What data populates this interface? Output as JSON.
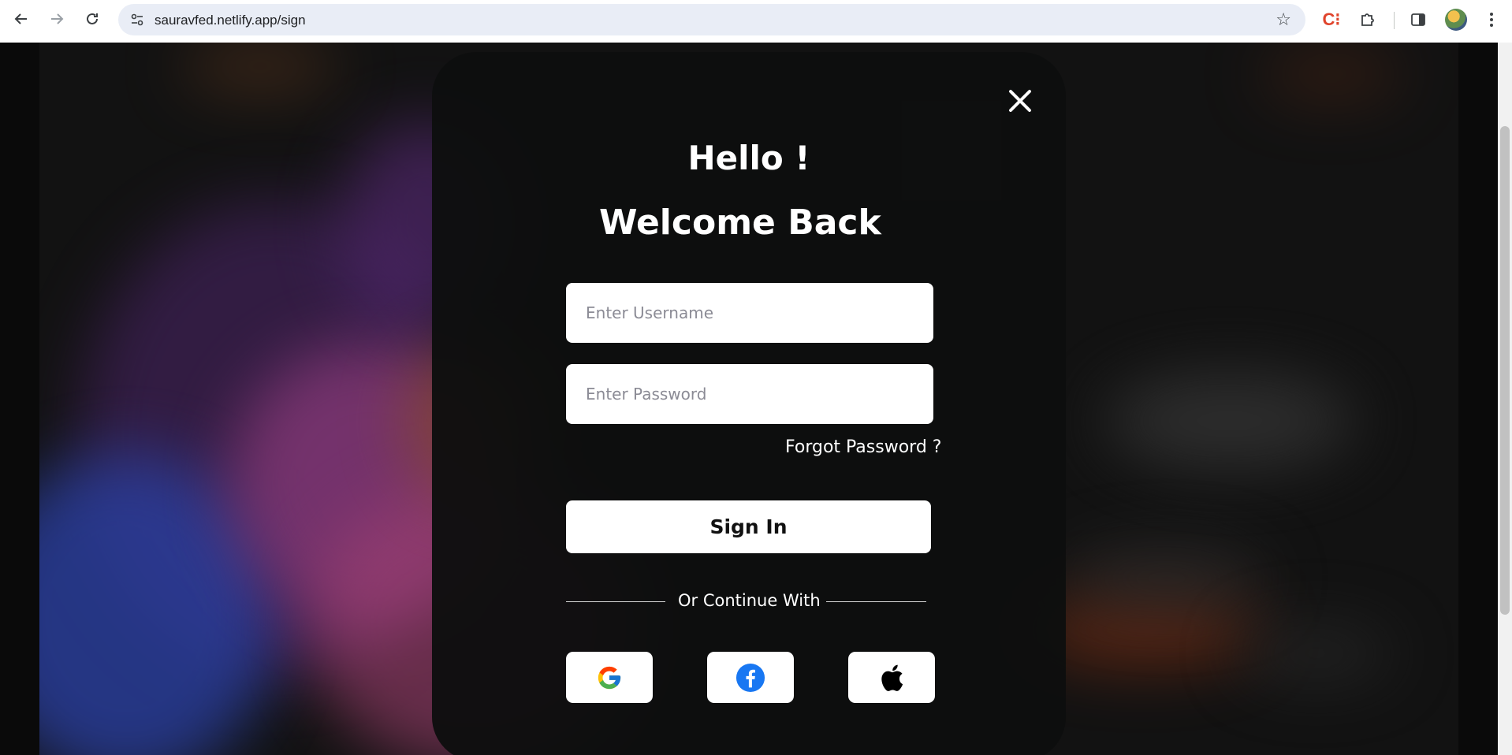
{
  "browser": {
    "url": "sauravfed.netlify.app/sign"
  },
  "modal": {
    "greeting": "Hello !",
    "subtitle": "Welcome Back",
    "username_placeholder": "Enter Username",
    "password_placeholder": "Enter Password",
    "forgot_label": "Forgot Password ?",
    "signin_label": "Sign In",
    "separator_label": "Or Continue With",
    "social": [
      {
        "name": "google-icon"
      },
      {
        "name": "facebook-icon"
      },
      {
        "name": "apple-icon"
      }
    ]
  },
  "colors": {
    "modal_bg": "#0e0f0f",
    "text": "#ffffff",
    "google_blue": "#4285F4",
    "google_red": "#EA4335",
    "google_yellow": "#FBBC05",
    "google_green": "#34A853",
    "facebook_blue": "#1877F2"
  }
}
